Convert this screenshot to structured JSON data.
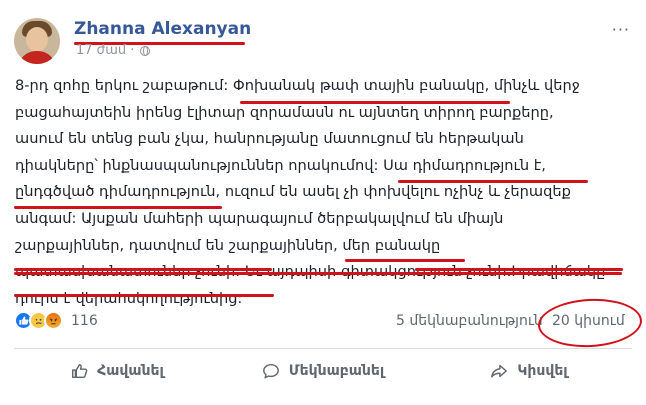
{
  "post": {
    "author": "Zhanna Alexanyan",
    "time": "17 ժամ ·",
    "more_label": "···",
    "text_lines": [
      "8-րդ զոհը երկու շաբաթում: Փոխանակ թափ տային բանակը, մինչև վերջ",
      "բացահայտեին իրենց էլիտար զորամասն ու այնտեղ տիրող բարքերը,",
      "ասում են տենց բան չկա, հանրությանը մատուցում են հերթական",
      "դիակները՝ ինքնասպանություններ որակումով: Սա դիմադրություն է,",
      "ընդգծված դիմադրություն, ուզում են ասել չի փոխվելու ոչինչ և չերազեք",
      "անգամ: Այսքան մահերի պարագայում ծերբակալվում են միայն",
      "շարքայիններ, դատվում են շարքայիններ, մեր բանակը",
      "պատասխանատուներ չունի: Եւ այդպիսի գիտակցություն չունի:Իրավիճակը",
      "դուրս է վերահսկողությունից:"
    ]
  },
  "stats": {
    "reaction_count": "116",
    "comments": "5 մեկնաբանություն",
    "shares": "20 կիսում"
  },
  "actions": {
    "like": "Հավանել",
    "comment": "Մեկնաբանել",
    "share": "Կիսվել"
  },
  "colors": {
    "author": "#365899",
    "annotation_red": "#d0121b",
    "secondary_text": "#606770"
  },
  "icons": [
    "globe-icon",
    "like-reaction-icon",
    "sad-reaction-icon",
    "angry-reaction-icon",
    "thumbs-up-icon",
    "comment-icon",
    "share-icon"
  ]
}
